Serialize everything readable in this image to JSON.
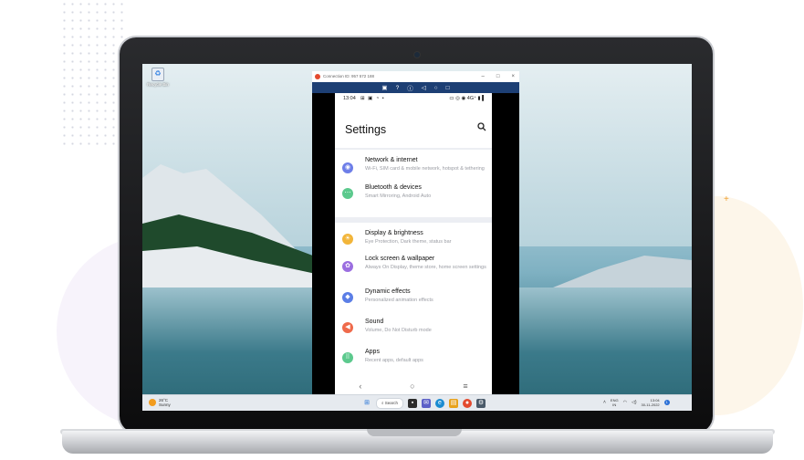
{
  "desktop": {
    "recycle_bin_label": "Recycle Bin"
  },
  "remote_window": {
    "title": "Connection ID: 957 572 188",
    "controls": [
      "–",
      "□",
      "×"
    ],
    "toolbar_icons": [
      "screen-icon",
      "help-icon",
      "info-icon",
      "back-icon",
      "home-icon",
      "recents-icon"
    ]
  },
  "phone": {
    "time": "13:04",
    "status_icons": "⊞ ▣ ◔ •",
    "right_status": "▭ ◎ ◉ 4G⁺ ▮ ▌",
    "settings_title": "Settings",
    "groups": [
      [
        {
          "title": "Network & internet",
          "subtitle": "Wi-Fi, SIM card & mobile network, hotspot & tethering",
          "color": "#6d7ee8",
          "icon": "wifi-icon"
        },
        {
          "title": "Bluetooth & devices",
          "subtitle": "Smart Mirroring, Android Auto",
          "color": "#5cc98d",
          "icon": "bluetooth-icon"
        }
      ],
      [
        {
          "title": "Display & brightness",
          "subtitle": "Eye Protection, Dark theme, status bar",
          "color": "#f2b53a",
          "icon": "brightness-icon"
        },
        {
          "title": "Lock screen & wallpaper",
          "subtitle": "Always On Display, theme store, home screen settings",
          "color": "#9b6ee0",
          "icon": "wallpaper-icon"
        },
        {
          "title": "Dynamic effects",
          "subtitle": "Personalized animation effects",
          "color": "#5b7ee6",
          "icon": "effects-icon"
        },
        {
          "title": "Sound",
          "subtitle": "Volume, Do Not Disturb mode",
          "color": "#ef6a4b",
          "icon": "sound-icon"
        },
        {
          "title": "Apps",
          "subtitle": "Recent apps, default apps",
          "color": "#5cc98d",
          "icon": "apps-icon"
        }
      ]
    ]
  },
  "taskbar": {
    "weather_temp": "26°C",
    "weather_desc": "Sunny",
    "search_label": "Search",
    "lang": "ENG",
    "region": "IN",
    "clock_time": "13:04",
    "clock_date": "30-11-2022",
    "notifications": "1"
  }
}
